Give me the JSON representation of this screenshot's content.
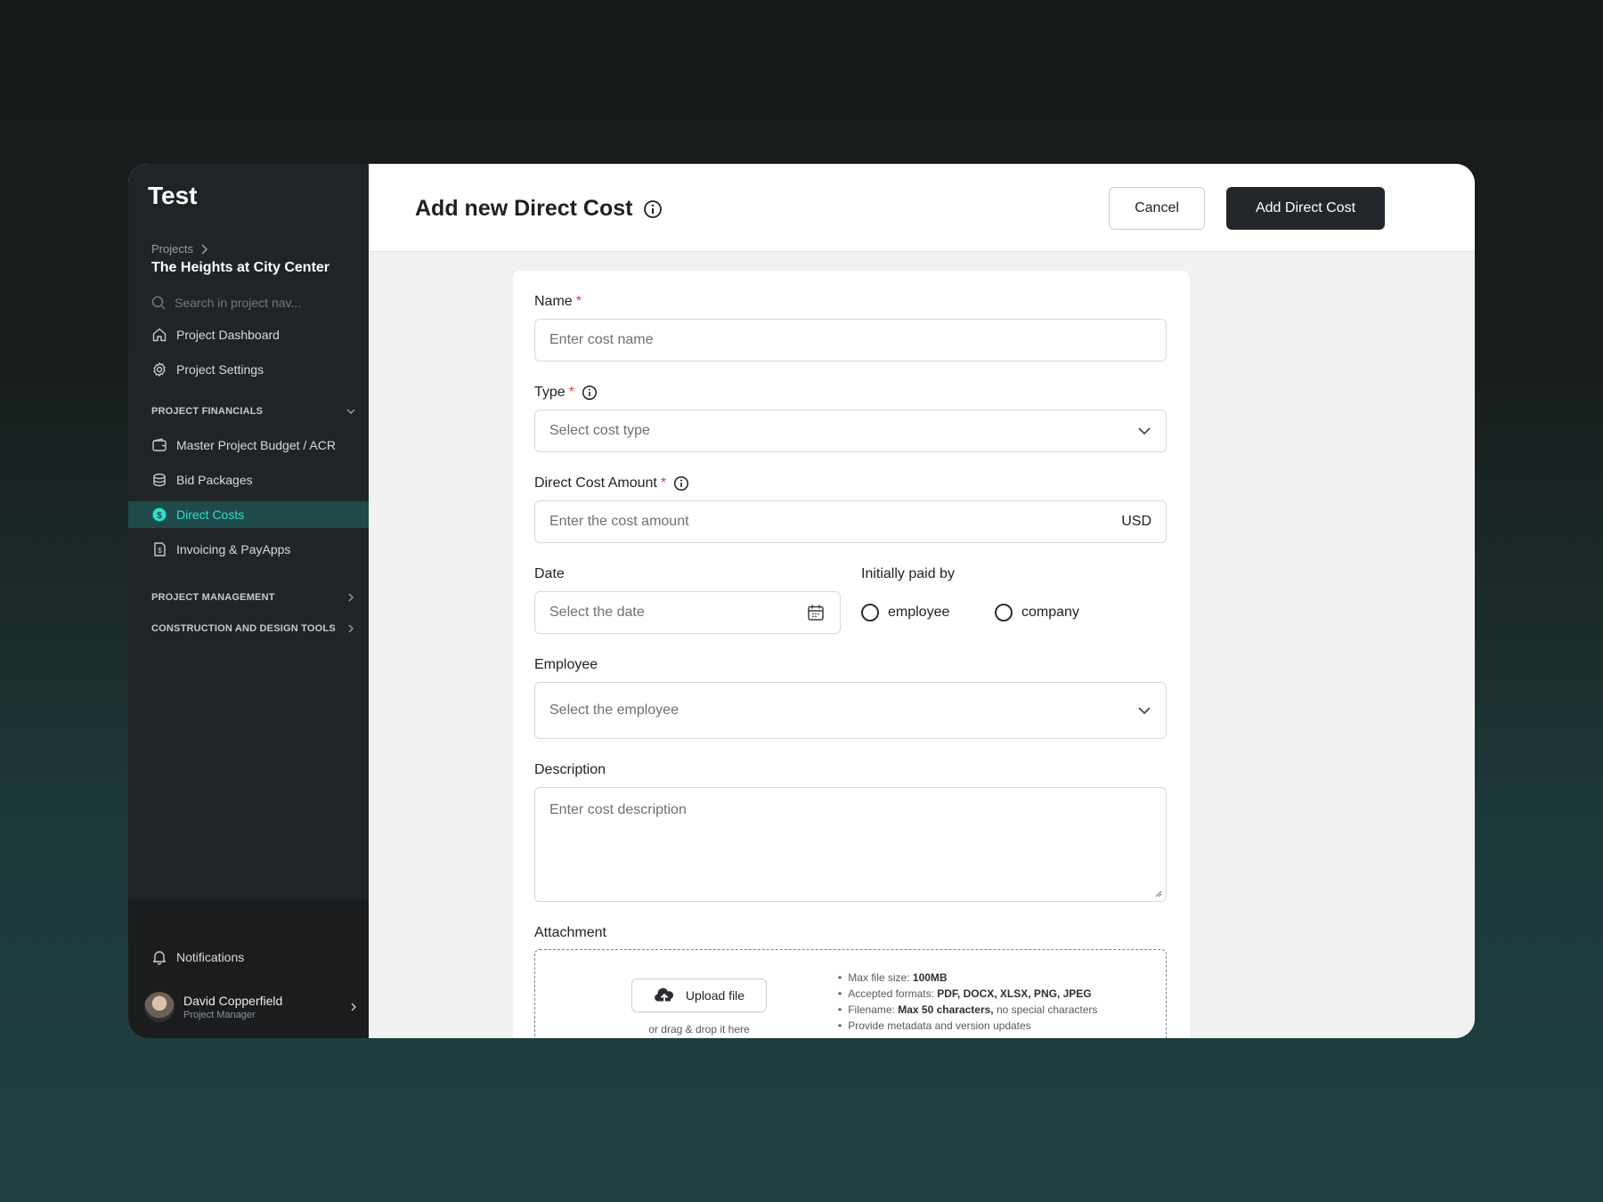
{
  "sidebar": {
    "brand": "Test",
    "breadcrumb": "Projects",
    "project_name": "The Heights at City Center",
    "search_placeholder": "Search in project nav...",
    "items": [
      {
        "label": "Project Dashboard",
        "icon": "home-icon"
      },
      {
        "label": "Project Settings",
        "icon": "gear-icon"
      }
    ],
    "financials": {
      "title": "PROJECT FINANCIALS",
      "items": [
        {
          "label": "Master Project Budget / ACR",
          "icon": "wallet-icon"
        },
        {
          "label": "Bid Packages",
          "icon": "coins-icon"
        },
        {
          "label": "Direct Costs",
          "icon": "dollar-circle-icon",
          "active": true
        },
        {
          "label": "Invoicing & PayApps",
          "icon": "invoice-icon"
        }
      ]
    },
    "sections": [
      "PROJECT MANAGEMENT",
      "CONSTRUCTION AND DESIGN TOOLS"
    ],
    "notifications_label": "Notifications",
    "user": {
      "name": "David Copperfield",
      "role": "Project Manager"
    },
    "active_color": "#2ee0c8"
  },
  "header": {
    "title": "Add new Direct Cost",
    "cancel_label": "Cancel",
    "submit_label": "Add Direct Cost"
  },
  "form": {
    "name": {
      "label": "Name",
      "required": "*",
      "placeholder": "Enter cost name"
    },
    "type": {
      "label": "Type",
      "required": "*",
      "placeholder": "Select cost type"
    },
    "amount": {
      "label": "Direct Cost Amount",
      "required": "*",
      "placeholder": "Enter the cost amount",
      "currency": "USD"
    },
    "date": {
      "label": "Date",
      "placeholder": "Select the date"
    },
    "paid_by": {
      "label": "Initially paid by",
      "options": [
        "employee",
        "company"
      ]
    },
    "employee": {
      "label": "Employee",
      "placeholder": "Select the employee"
    },
    "description": {
      "label": "Description",
      "placeholder": "Enter cost description"
    },
    "attachment": {
      "label": "Attachment",
      "upload_label": "Upload file",
      "drag_hint": "or drag & drop it here",
      "rules": [
        {
          "prefix": "Max file size: ",
          "bold": "100MB",
          "suffix": ""
        },
        {
          "prefix": "Accepted formats: ",
          "bold": "PDF, DOCX, XLSX, PNG, JPEG",
          "suffix": ""
        },
        {
          "prefix": "Filename: ",
          "bold": "Max 50 characters,",
          "suffix": " no special characters"
        },
        {
          "prefix": "Provide metadata and version updates",
          "bold": "",
          "suffix": ""
        }
      ]
    }
  }
}
